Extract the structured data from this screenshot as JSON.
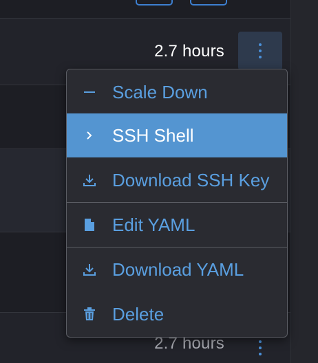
{
  "rows": [
    {
      "duration": "2.7 hours"
    },
    {
      "duration": "2.7 hours"
    }
  ],
  "menu": {
    "items": [
      {
        "label": "Scale Down",
        "icon": "minus-icon"
      },
      {
        "label": "SSH Shell",
        "icon": "chevron-right-icon",
        "active": true
      },
      {
        "label": "Download SSH Key",
        "icon": "download-icon"
      },
      {
        "label": "Edit YAML",
        "icon": "file-icon"
      },
      {
        "label": "Download YAML",
        "icon": "download-icon"
      },
      {
        "label": "Delete",
        "icon": "trash-icon"
      }
    ]
  },
  "colors": {
    "accent": "#5a9fe0",
    "active_bg": "#5495d1",
    "menu_bg": "#2a2b31",
    "page_bg": "#1b1c21"
  }
}
